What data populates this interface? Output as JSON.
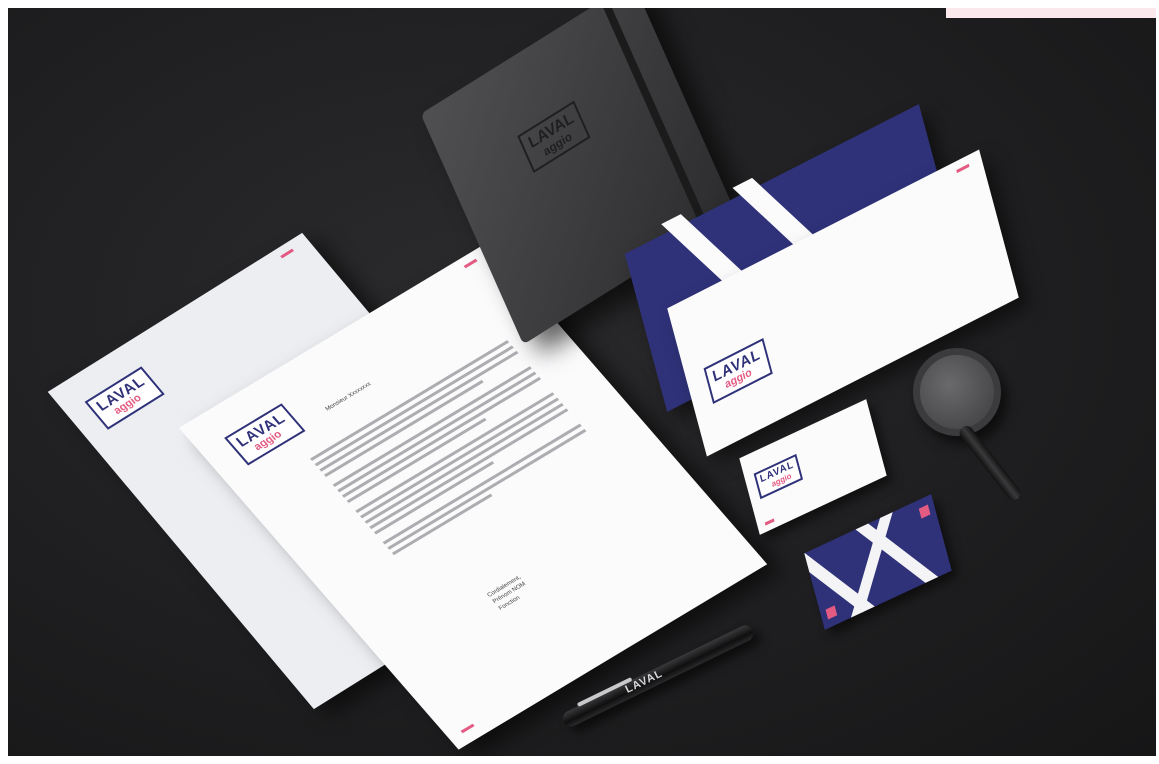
{
  "brand": {
    "logo_top": "LAVAL",
    "logo_bottom": "aggio",
    "primary_color": "#2f3279",
    "accent_color": "#e35b82"
  },
  "letter": {
    "salutation": "Monsieur Xxxxxxxx",
    "signature_lines": [
      "Cordialement,",
      "Prénom NOM",
      "Fonction"
    ]
  },
  "pen": {
    "label": "LAVAL"
  }
}
